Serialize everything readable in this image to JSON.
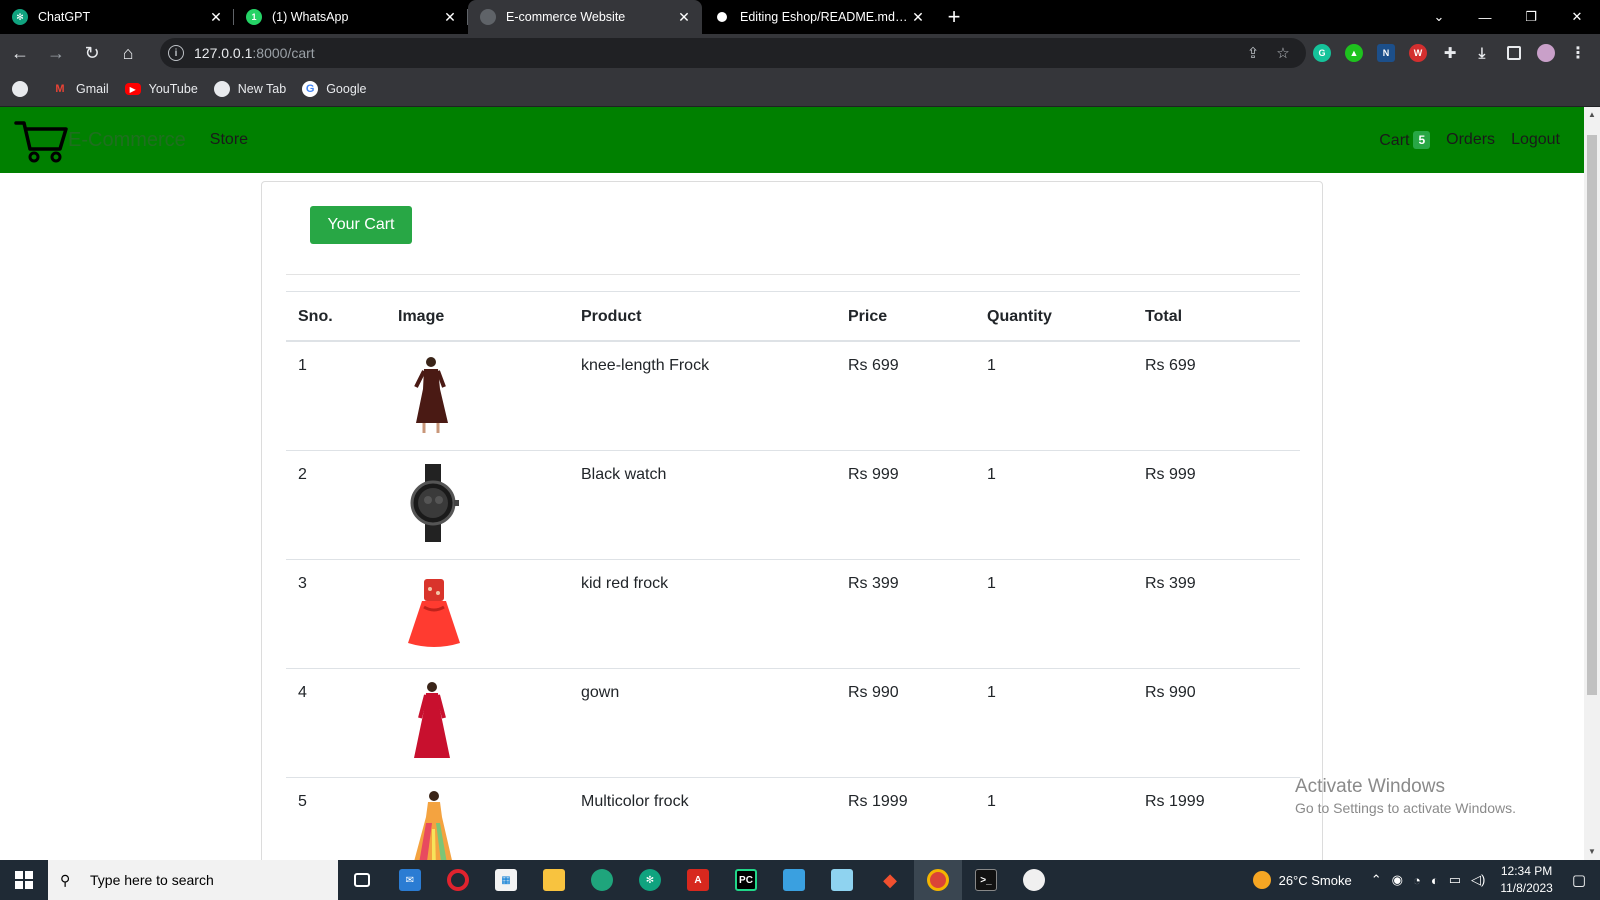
{
  "browser": {
    "tabs": [
      {
        "title": "ChatGPT",
        "icon": "chatgpt-icon",
        "color": "#10a37f"
      },
      {
        "title": "(1) WhatsApp",
        "icon": "whatsapp-icon",
        "color": "#25d366"
      },
      {
        "title": "E-commerce Website",
        "icon": "globe-icon",
        "color": "#5f6368"
      },
      {
        "title": "Editing Eshop/README.md at m",
        "icon": "github-icon",
        "color": "#000000"
      }
    ],
    "url_host": "127.0.0.1",
    "url_path": ":8000/cart",
    "bookmarks": [
      {
        "label": "Gmail",
        "icon": "gmail-icon"
      },
      {
        "label": "YouTube",
        "icon": "youtube-icon"
      },
      {
        "label": "New Tab",
        "icon": "globe-icon"
      },
      {
        "label": "Google",
        "icon": "google-icon"
      }
    ]
  },
  "site": {
    "brand": "E-Commerce",
    "nav_store": "Store",
    "nav_cart": "Cart",
    "cart_count": "5",
    "nav_orders": "Orders",
    "nav_logout": "Logout",
    "accent_color": "#008000",
    "button_color": "#28a745"
  },
  "cart": {
    "heading_button": "Your Cart",
    "columns": [
      "Sno.",
      "Image",
      "Product",
      "Price",
      "Quantity",
      "Total"
    ],
    "rows": [
      {
        "sno": "1",
        "product": "knee-length Frock",
        "price": "Rs 699",
        "quantity": "1",
        "total": "Rs 699",
        "image": "brown-frock"
      },
      {
        "sno": "2",
        "product": "Black watch",
        "price": "Rs 999",
        "quantity": "1",
        "total": "Rs 999",
        "image": "black-watch"
      },
      {
        "sno": "3",
        "product": "kid red frock",
        "price": "Rs 399",
        "quantity": "1",
        "total": "Rs 399",
        "image": "red-kid-frock"
      },
      {
        "sno": "4",
        "product": "gown",
        "price": "Rs 990",
        "quantity": "1",
        "total": "Rs 990",
        "image": "red-gown"
      },
      {
        "sno": "5",
        "product": "Multicolor frock",
        "price": "Rs 1999",
        "quantity": "1",
        "total": "Rs 1999",
        "image": "multicolor-frock"
      }
    ]
  },
  "watermark": {
    "title": "Activate Windows",
    "subtitle": "Go to Settings to activate Windows."
  },
  "taskbar": {
    "search_placeholder": "Type here to search",
    "weather": "26°C  Smoke",
    "time": "12:34 PM",
    "date": "11/8/2023"
  }
}
